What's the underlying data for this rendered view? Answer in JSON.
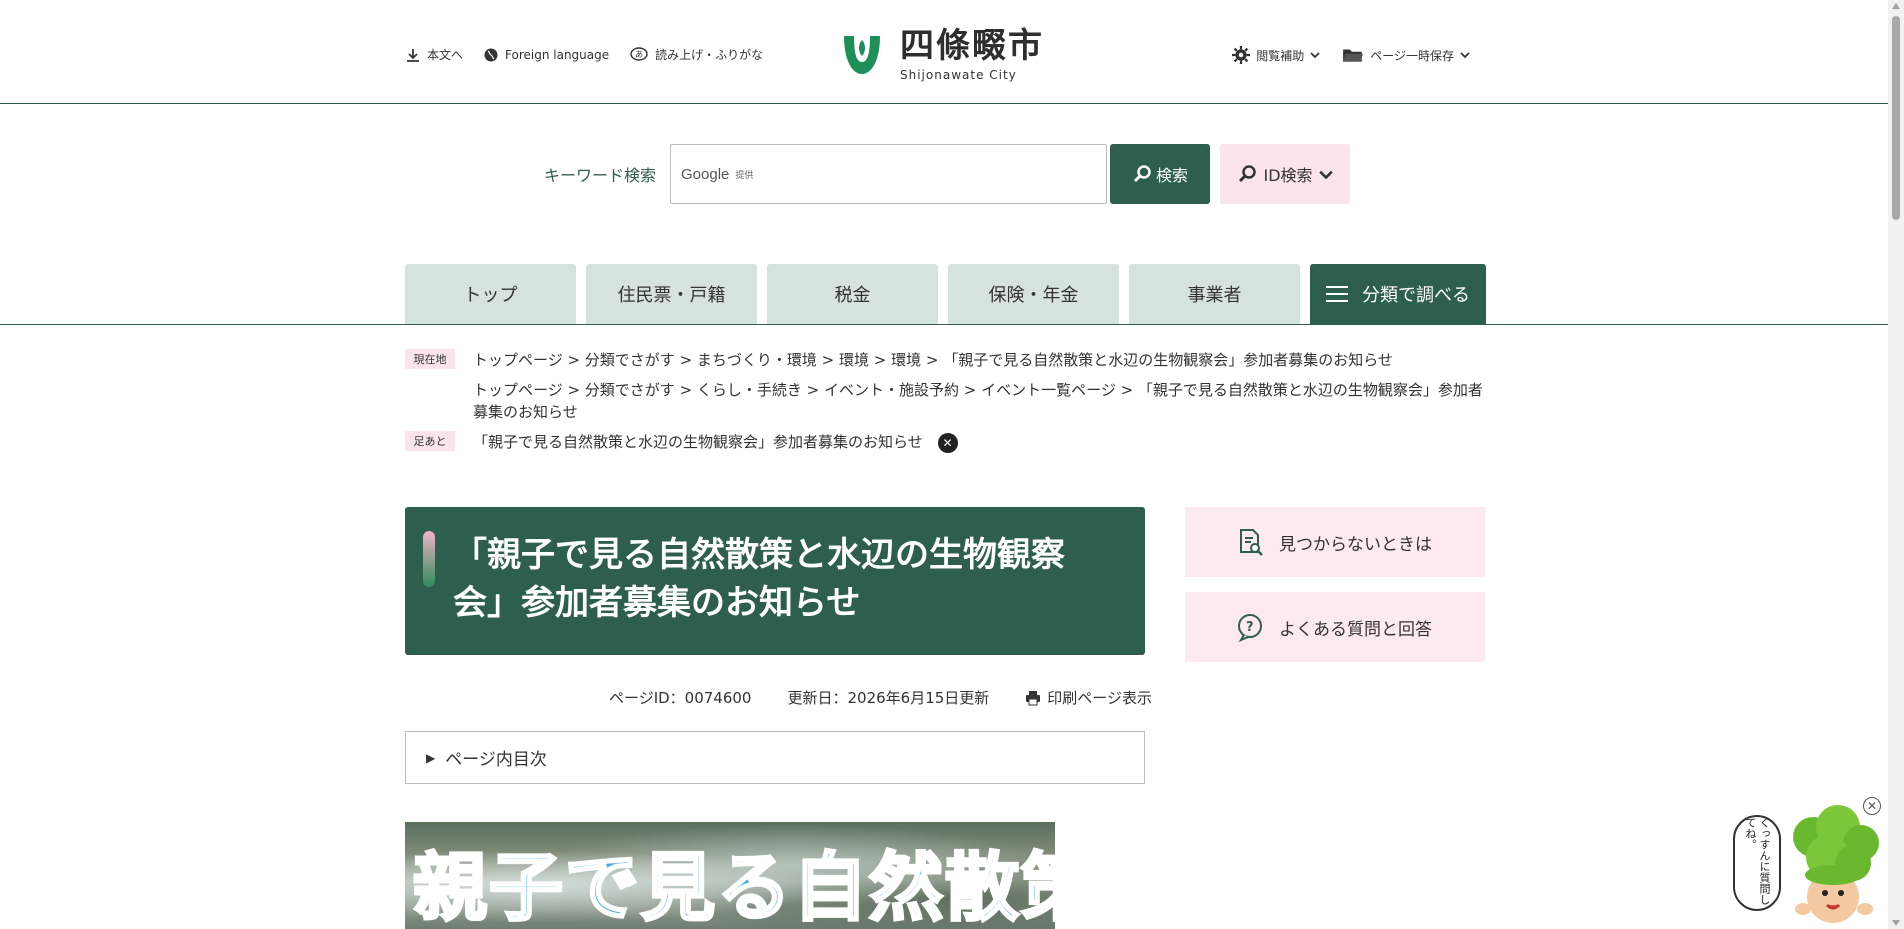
{
  "header": {
    "util_links": [
      {
        "label": "本文へ",
        "icon": "download-icon"
      },
      {
        "label": "Foreign language",
        "icon": "globe-icon"
      },
      {
        "label": "読み上げ・ふりがな",
        "icon": "speech-bubble-icon"
      }
    ],
    "logo": {
      "name": "四條畷市",
      "sub": "Shijonawate City"
    },
    "util_right": [
      {
        "label": "閲覧補助",
        "icon": "gear-icon"
      },
      {
        "label": "ページ一時保存",
        "icon": "folder-icon"
      }
    ]
  },
  "search": {
    "label": "キーワード検索",
    "placeholder_brand": "Google",
    "placeholder_sub": "提供",
    "search_button": "検索",
    "id_button": "ID検索"
  },
  "nav": {
    "items": [
      "トップ",
      "住民票・戸籍",
      "税金",
      "保険・年金",
      "事業者"
    ],
    "category_button": "分類で調べる"
  },
  "breadcrumb": {
    "current_tag": "現在地",
    "path1": "トップページ > 分類でさがす > まちづくり・環境 > 環境 > 環境 > 「親子で見る自然散策と水辺の生物観察会」参加者募集のお知らせ",
    "path2": "トップページ > 分類でさがす > くらし・手続き > イベント・施設予約 > イベント一覧ページ > 「親子で見る自然散策と水辺の生物観察会」参加者募集のお知らせ",
    "footprint_tag": "足あと",
    "footprint": "「親子で見る自然散策と水辺の生物観察会」参加者募集のお知らせ"
  },
  "main": {
    "title": "「親子で見る自然散策と水辺の生物観察会」参加者募集のお知らせ",
    "page_id": "ページID：0074600",
    "updated": "更新日：2026年6月15日更新",
    "print": "印刷ページ表示",
    "toc": "ページ内目次",
    "hero_text": "親子で見る自然散策と"
  },
  "side": {
    "not_found": "見つからないときは",
    "faq": "よくある質問と回答"
  },
  "mascot": {
    "speech": "くっすんに質問してね。"
  },
  "colors": {
    "brand_green": "#2e5e4e",
    "nav_light": "#d5e2dd",
    "pink": "#fbe4ec"
  }
}
